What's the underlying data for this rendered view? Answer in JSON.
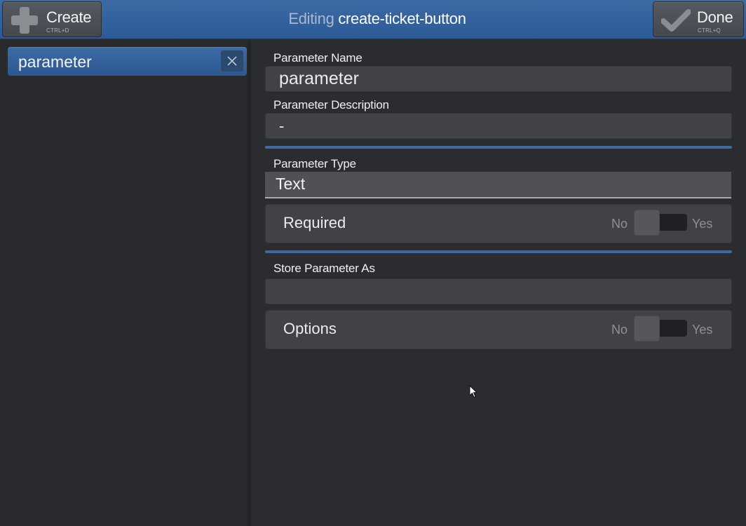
{
  "header": {
    "create_label": "Create",
    "create_shortcut": "CTRL+D",
    "title_prefix": "Editing",
    "title_name": "create-ticket-button",
    "done_label": "Done",
    "done_shortcut": "CTRL+Q"
  },
  "sidebar": {
    "items": [
      {
        "label": "parameter"
      }
    ]
  },
  "form": {
    "name_label": "Parameter Name",
    "name_value": "parameter",
    "description_label": "Parameter Description",
    "description_value": "-",
    "type_label": "Parameter Type",
    "type_value": "Text",
    "required": {
      "label": "Required",
      "no": "No",
      "yes": "Yes",
      "value": false
    },
    "store_label": "Store Parameter As",
    "store_value": "",
    "options": {
      "label": "Options",
      "no": "No",
      "yes": "Yes",
      "value": false
    }
  },
  "colors": {
    "accent": "#3e6aa3",
    "header": "#2f5d98",
    "background": "#2b2c30"
  }
}
